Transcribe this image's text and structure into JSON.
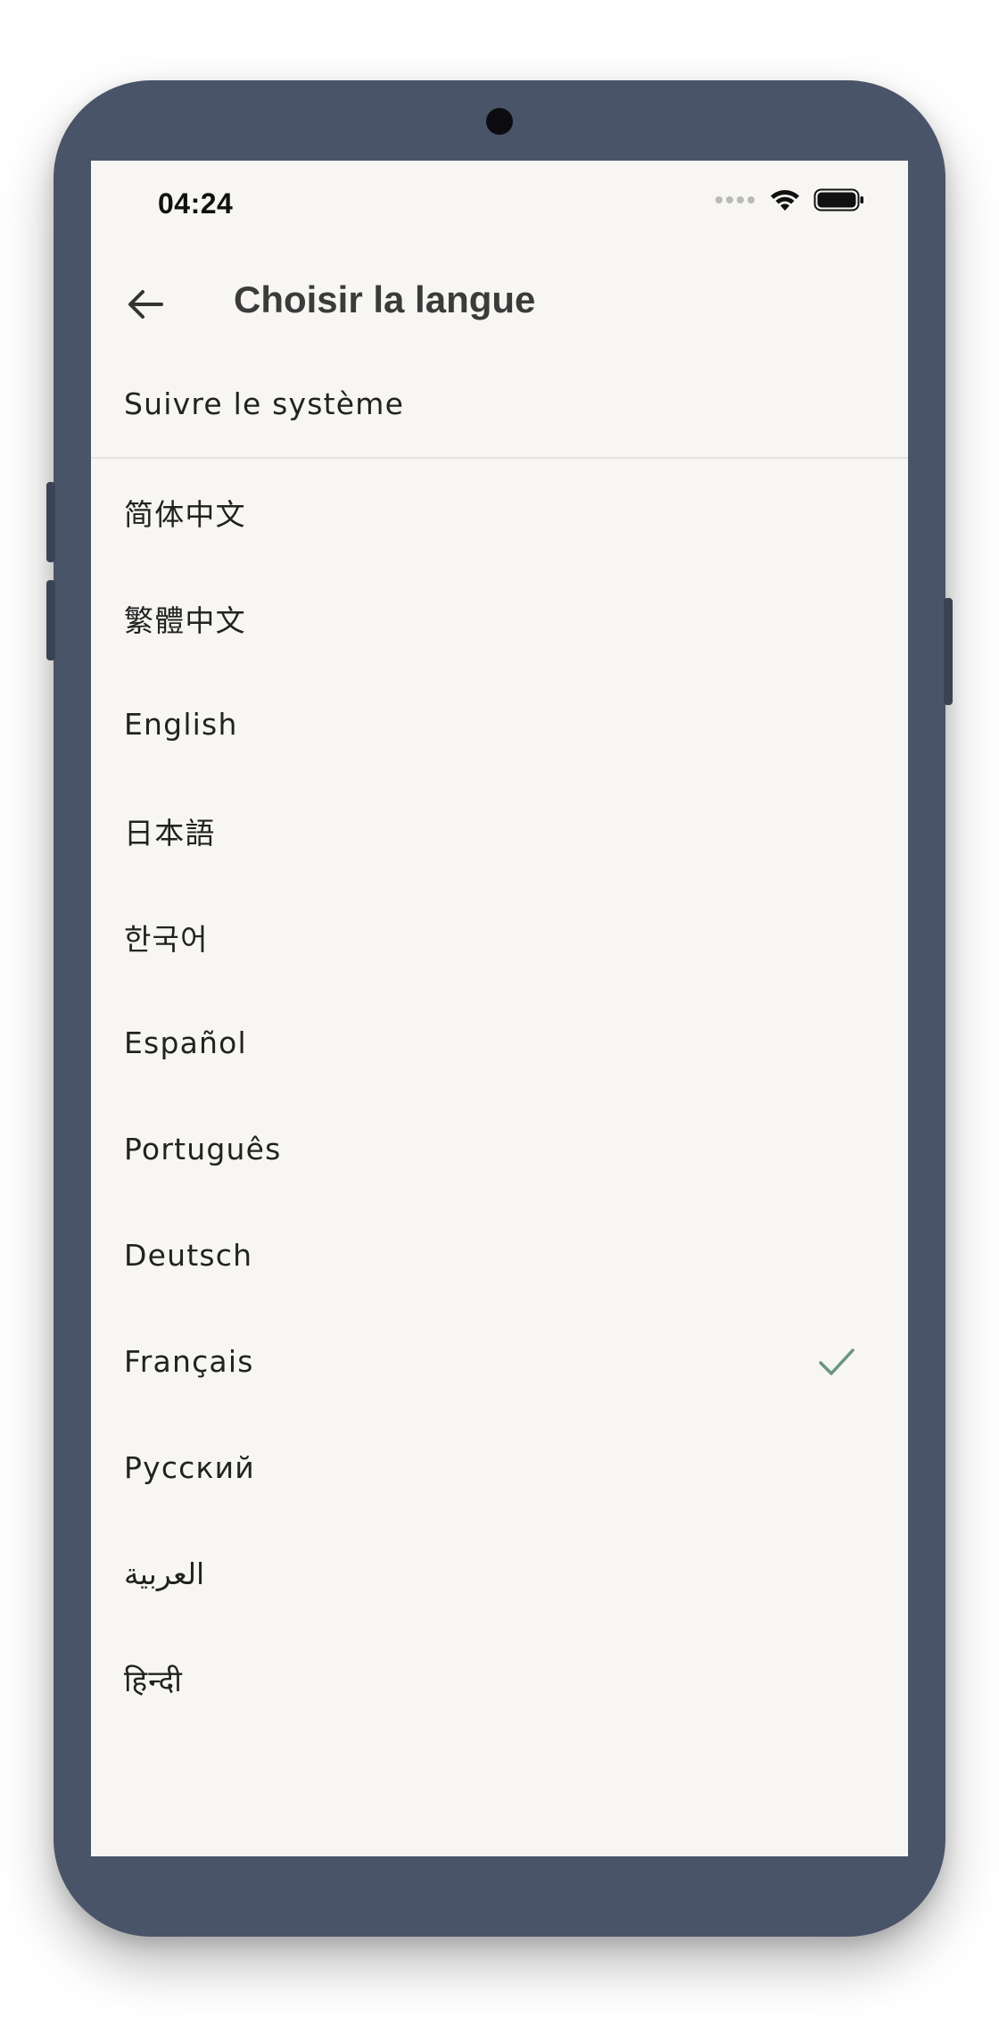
{
  "status_bar": {
    "time": "04:24",
    "icons": [
      "signal-dots-icon",
      "wifi-icon",
      "battery-icon"
    ]
  },
  "app_bar": {
    "back_icon": "arrow-left-icon",
    "title": "Choisir la langue"
  },
  "system_option": {
    "label": "Suivre le système"
  },
  "languages": [
    {
      "label": "简体中文",
      "selected": false
    },
    {
      "label": "繁體中文",
      "selected": false
    },
    {
      "label": "English",
      "selected": false
    },
    {
      "label": "日本語",
      "selected": false
    },
    {
      "label": "한국어",
      "selected": false
    },
    {
      "label": "Español",
      "selected": false
    },
    {
      "label": "Português",
      "selected": false
    },
    {
      "label": "Deutsch",
      "selected": false
    },
    {
      "label": "Français",
      "selected": true
    },
    {
      "label": "Русский",
      "selected": false
    },
    {
      "label": "العربية",
      "selected": false
    },
    {
      "label": "हिन्दी",
      "selected": false
    }
  ],
  "colors": {
    "device_frame": "#4a5468",
    "screen_bg": "#f7f6f2",
    "check_accent": "#6a9484",
    "text_primary": "#222222",
    "title_text": "#3b3b3b"
  }
}
